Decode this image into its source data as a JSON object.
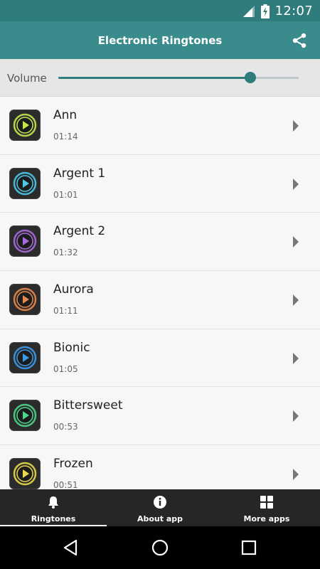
{
  "status_bar": {
    "time": "12:07",
    "signal_icon": "signal-icon",
    "battery_icon": "battery-charging-icon"
  },
  "app_bar": {
    "title": "Electronic Ringtones",
    "share_icon": "share-icon"
  },
  "volume": {
    "label": "Volume",
    "level": 0.8,
    "accent": "#2f7c7d"
  },
  "ringtones": [
    {
      "title": "Ann",
      "duration": "01:14",
      "ring_color": "#c4e84a"
    },
    {
      "title": "Argent 1",
      "duration": "01:01",
      "ring_color": "#4ac8e8"
    },
    {
      "title": "Argent 2",
      "duration": "01:32",
      "ring_color": "#a86ae0"
    },
    {
      "title": "Aurora",
      "duration": "01:11",
      "ring_color": "#e8884a"
    },
    {
      "title": "Bionic",
      "duration": "01:05",
      "ring_color": "#3a9ae8"
    },
    {
      "title": "Bittersweet",
      "duration": "00:53",
      "ring_color": "#4ad88a"
    },
    {
      "title": "Frozen",
      "duration": "00:51",
      "ring_color": "#e8d84a"
    }
  ],
  "bottom_nav": [
    {
      "label": "Ringtones",
      "icon": "bell-icon",
      "active": true
    },
    {
      "label": "About app",
      "icon": "info-icon",
      "active": false
    },
    {
      "label": "More apps",
      "icon": "grid-icon",
      "active": false
    }
  ],
  "system_nav": {
    "back_icon": "back-icon",
    "home_icon": "home-icon",
    "recents_icon": "recents-icon"
  },
  "colors": {
    "status_bar": "#2f7c7d",
    "app_bar": "#3a8b8c",
    "bottom_nav": "#262626"
  }
}
